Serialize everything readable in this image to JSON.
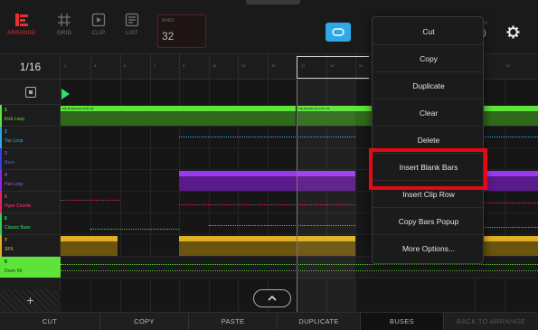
{
  "topbar": {
    "modes": [
      {
        "label": "ARRANGE",
        "icon": "arrange-icon",
        "active": true
      },
      {
        "label": "GRID",
        "icon": "grid-icon",
        "active": false
      },
      {
        "label": "CLIP",
        "icon": "clip-icon",
        "active": false
      },
      {
        "label": "LIST",
        "icon": "list-icon",
        "active": false
      }
    ],
    "bars_label": "BARS",
    "bars_value": "32",
    "loop_icon": "loop-icon",
    "settings_icon": "gear-icon",
    "partial_label": "K",
    "partial_value": "0"
  },
  "quantize": "1/16",
  "ruler_numbers": [
    "1",
    "3",
    "5",
    "7",
    "9",
    "11",
    "13",
    "15",
    "17",
    "19",
    "21",
    "31"
  ],
  "tracks": [
    {
      "num": "1",
      "name": "Kick Loop",
      "color": "#5ee33a",
      "selected": false
    },
    {
      "num": "2",
      "name": "Top Loop",
      "color": "#2fa8e8",
      "selected": false
    },
    {
      "num": "3",
      "name": "Bass",
      "color": "#3d3de0",
      "selected": false
    },
    {
      "num": "4",
      "name": "Hat Loop",
      "color": "#8a2be2",
      "selected": false
    },
    {
      "num": "5",
      "name": "Hype Chords",
      "color": "#e0246a",
      "selected": false
    },
    {
      "num": "6",
      "name": "Classic Bass",
      "color": "#2ed25a",
      "selected": false
    },
    {
      "num": "7",
      "name": "SFX",
      "color": "#e0b020",
      "selected": false
    },
    {
      "num": "8",
      "name": "Drum Kit",
      "color": "#5ee33a",
      "selected": true
    }
  ],
  "clips": {
    "kick_a": "Clip DeepHouse Drum Kit",
    "kick_b": "Clip DeepHouse Drum Kit"
  },
  "menu": {
    "items": [
      "Cut",
      "Copy",
      "Duplicate",
      "Clear",
      "Delete",
      "Insert Blank Bars",
      "Insert Clip Row",
      "Copy Bars Popup",
      "More Options..."
    ],
    "highlighted": "Insert Blank Bars"
  },
  "bottombar": {
    "cut": "CUT",
    "copy": "COPY",
    "paste": "PASTE",
    "duplicate": "DUPLICATE",
    "buses": "BUSES",
    "back": "BACK TO ARRANGE"
  },
  "add_track_label": "+",
  "colors": {
    "accent_red": "#e8302f",
    "loop_blue": "#2fa8e8",
    "highlight": "#e50914"
  }
}
